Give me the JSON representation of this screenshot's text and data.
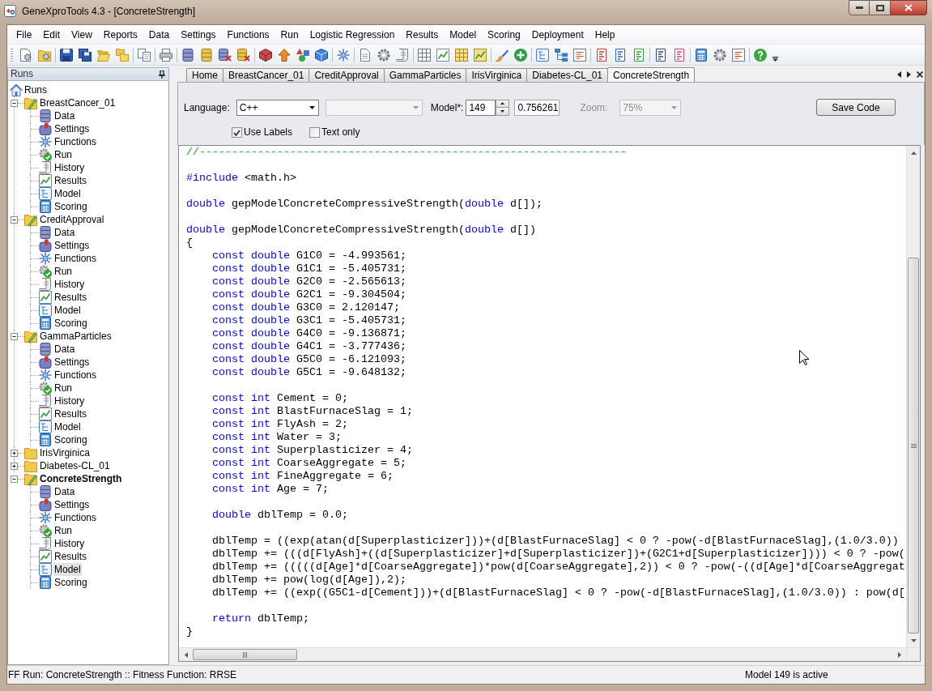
{
  "window": {
    "title": "GeneXproTools 4.3 - [ConcreteStrength]"
  },
  "menu": [
    "File",
    "Edit",
    "View",
    "Reports",
    "Data",
    "Settings",
    "Functions",
    "Run",
    "Logistic Regression",
    "Results",
    "Model",
    "Scoring",
    "Deployment",
    "Help"
  ],
  "runs_panel": {
    "title": "Runs",
    "tree": {
      "label": "Runs",
      "children": [
        {
          "label": "BreastCancer_01",
          "expanded": true,
          "active": false,
          "children": [
            {
              "label": "Data",
              "selected": false
            },
            {
              "label": "Settings",
              "selected": false
            },
            {
              "label": "Functions",
              "selected": false
            },
            {
              "label": "Run",
              "selected": false
            },
            {
              "label": "History",
              "selected": false
            },
            {
              "label": "Results",
              "selected": false
            },
            {
              "label": "Model",
              "selected": false
            },
            {
              "label": "Scoring",
              "selected": false
            }
          ]
        },
        {
          "label": "CreditApproval",
          "expanded": true,
          "active": false,
          "children": [
            {
              "label": "Data",
              "selected": false
            },
            {
              "label": "Settings",
              "selected": false
            },
            {
              "label": "Functions",
              "selected": false
            },
            {
              "label": "Run",
              "selected": false
            },
            {
              "label": "History",
              "selected": false
            },
            {
              "label": "Results",
              "selected": false
            },
            {
              "label": "Model",
              "selected": false
            },
            {
              "label": "Scoring",
              "selected": false
            }
          ]
        },
        {
          "label": "GammaParticles",
          "expanded": true,
          "active": false,
          "children": [
            {
              "label": "Data",
              "selected": false
            },
            {
              "label": "Settings",
              "selected": false
            },
            {
              "label": "Functions",
              "selected": false
            },
            {
              "label": "Run",
              "selected": false
            },
            {
              "label": "History",
              "selected": false
            },
            {
              "label": "Results",
              "selected": false
            },
            {
              "label": "Model",
              "selected": false
            },
            {
              "label": "Scoring",
              "selected": false
            }
          ]
        },
        {
          "label": "IrisVirginica",
          "expanded": false,
          "active": false
        },
        {
          "label": "Diabetes-CL_01",
          "expanded": false,
          "active": false
        },
        {
          "label": "ConcreteStrength",
          "expanded": true,
          "active": true,
          "children": [
            {
              "label": "Data",
              "selected": false
            },
            {
              "label": "Settings",
              "selected": false
            },
            {
              "label": "Functions",
              "selected": false
            },
            {
              "label": "Run",
              "selected": false
            },
            {
              "label": "History",
              "selected": false
            },
            {
              "label": "Results",
              "selected": false
            },
            {
              "label": "Model",
              "selected": true
            },
            {
              "label": "Scoring",
              "selected": false
            }
          ]
        }
      ]
    }
  },
  "tabs": [
    {
      "label": "Home",
      "selected": false
    },
    {
      "label": "BreastCancer_01",
      "selected": false
    },
    {
      "label": "CreditApproval",
      "selected": false
    },
    {
      "label": "GammaParticles",
      "selected": false
    },
    {
      "label": "IrisVirginica",
      "selected": false
    },
    {
      "label": "Diabetes-CL_01",
      "selected": false
    },
    {
      "label": "ConcreteStrength",
      "selected": true
    }
  ],
  "options": {
    "language_label": "Language:",
    "language": "C++",
    "select_2": {
      "disabled": true
    },
    "model_label": "Model*:",
    "model_number": "149",
    "value_field": "0.756261",
    "zoom": {
      "label": "Zoom:",
      "value": "75%",
      "disabled": true
    },
    "save_button": "Save Code",
    "checkboxes": [
      {
        "label": "Use Labels",
        "checked": true
      },
      {
        "label": "Text only",
        "checked": false
      }
    ]
  },
  "editor": {
    "blocks": [
      {
        "lines": [
          [
            {
              "kind": "comment",
              "text": "//------------------------------------------------------------------"
            }
          ]
        ]
      },
      {
        "lines": [
          [
            {
              "kind": "keyword",
              "text": "#include"
            },
            {
              "kind": "plain",
              "text": " <math.h>"
            }
          ]
        ]
      },
      {
        "lines": [
          [
            {
              "kind": "keyword",
              "text": "double"
            },
            {
              "kind": "plain",
              "text": " gepModelConcreteCompressiveStrength("
            },
            {
              "kind": "keyword",
              "text": "double"
            },
            {
              "kind": "plain",
              "text": " d[]);"
            }
          ]
        ]
      },
      {
        "lines": [
          [
            {
              "kind": "keyword",
              "text": "double"
            },
            {
              "kind": "plain",
              "text": " gepModelConcreteCompressiveStrength("
            },
            {
              "kind": "keyword",
              "text": "double"
            },
            {
              "kind": "plain",
              "text": " d[])"
            }
          ],
          [
            {
              "kind": "plain",
              "text": "{"
            }
          ]
        ],
        "children": [
          {
            "lines": [
              [
                {
                  "kind": "keyword",
                  "text": "const double"
                },
                {
                  "kind": "plain",
                  "text": " G1C0 = -4.993561;"
                }
              ],
              [
                {
                  "kind": "keyword",
                  "text": "const double"
                },
                {
                  "kind": "plain",
                  "text": " G1C1 = -5.405731;"
                }
              ],
              [
                {
                  "kind": "keyword",
                  "text": "const double"
                },
                {
                  "kind": "plain",
                  "text": " G2C0 = -2.565613;"
                }
              ],
              [
                {
                  "kind": "keyword",
                  "text": "const double"
                },
                {
                  "kind": "plain",
                  "text": " G2C1 = -9.304504;"
                }
              ],
              [
                {
                  "kind": "keyword",
                  "text": "const double"
                },
                {
                  "kind": "plain",
                  "text": " G3C0 = 2.120147;"
                }
              ],
              [
                {
                  "kind": "keyword",
                  "text": "const double"
                },
                {
                  "kind": "plain",
                  "text": " G3C1 = -5.405731;"
                }
              ],
              [
                {
                  "kind": "keyword",
                  "text": "const double"
                },
                {
                  "kind": "plain",
                  "text": " G4C0 = -9.136871;"
                }
              ],
              [
                {
                  "kind": "keyword",
                  "text": "const double"
                },
                {
                  "kind": "plain",
                  "text": " G4C1 = -3.777436;"
                }
              ],
              [
                {
                  "kind": "keyword",
                  "text": "const double"
                },
                {
                  "kind": "plain",
                  "text": " G5C0 = -6.121093;"
                }
              ],
              [
                {
                  "kind": "keyword",
                  "text": "const double"
                },
                {
                  "kind": "plain",
                  "text": " G5C1 = -9.648132;"
                }
              ]
            ]
          },
          {
            "lines": [
              [
                {
                  "kind": "keyword",
                  "text": "const int"
                },
                {
                  "kind": "plain",
                  "text": " Cement = 0;"
                }
              ],
              [
                {
                  "kind": "keyword",
                  "text": "const int"
                },
                {
                  "kind": "plain",
                  "text": " BlastFurnaceSlag = 1;"
                }
              ],
              [
                {
                  "kind": "keyword",
                  "text": "const int"
                },
                {
                  "kind": "plain",
                  "text": " FlyAsh = 2;"
                }
              ],
              [
                {
                  "kind": "keyword",
                  "text": "const int"
                },
                {
                  "kind": "plain",
                  "text": " Water = 3;"
                }
              ],
              [
                {
                  "kind": "keyword",
                  "text": "const int"
                },
                {
                  "kind": "plain",
                  "text": " Superplasticizer = 4;"
                }
              ],
              [
                {
                  "kind": "keyword",
                  "text": "const int"
                },
                {
                  "kind": "plain",
                  "text": " CoarseAggregate = 5;"
                }
              ],
              [
                {
                  "kind": "keyword",
                  "text": "const int"
                },
                {
                  "kind": "plain",
                  "text": " FineAggregate = 6;"
                }
              ],
              [
                {
                  "kind": "keyword",
                  "text": "const int"
                },
                {
                  "kind": "plain",
                  "text": " Age = 7;"
                }
              ]
            ]
          },
          {
            "lines": [
              [
                {
                  "kind": "keyword",
                  "text": "double"
                },
                {
                  "kind": "plain",
                  "text": " dblTemp = 0.0;"
                }
              ]
            ]
          },
          {
            "lines": [
              [
                {
                  "kind": "plain",
                  "text": "dblTemp = ((exp(atan(d[Superplasticizer]))+(d[BlastFurnaceSlag] < 0 ? -pow(-d[BlastFurnaceSlag],(1.0/3.0))"
                }
              ],
              [
                {
                  "kind": "plain",
                  "text": "dblTemp += (((d[FlyAsh]+((d[Superplasticizer]+d[Superplasticizer])+(G2C1+d[Superplasticizer]))) < 0 ? -pow("
                }
              ],
              [
                {
                  "kind": "plain",
                  "text": "dblTemp += (((((d[Age]*d[CoarseAggregate])*pow(d[CoarseAggregate],2)) < 0 ? -pow(-((d[Age]*d[CoarseAggregat"
                }
              ],
              [
                {
                  "kind": "plain",
                  "text": "dblTemp += pow(log(d[Age]),2);"
                }
              ],
              [
                {
                  "kind": "plain",
                  "text": "dblTemp += ((exp((G5C1-d[Cement]))+(d[BlastFurnaceSlag] < 0 ? -pow(-d[BlastFurnaceSlag],(1.0/3.0)) : pow(d["
                }
              ]
            ]
          },
          {
            "lines": [
              [
                {
                  "kind": "keyword",
                  "text": "return"
                },
                {
                  "kind": "plain",
                  "text": " dblTemp;"
                }
              ]
            ]
          }
        ],
        "closing_lines": [
          [
            {
              "kind": "plain",
              "text": "}"
            }
          ]
        ]
      }
    ]
  },
  "status_bar": {
    "left": "FF Run: ConcreteStrength :: Fitness Function: RRSE",
    "right": "Model 149 is active"
  }
}
